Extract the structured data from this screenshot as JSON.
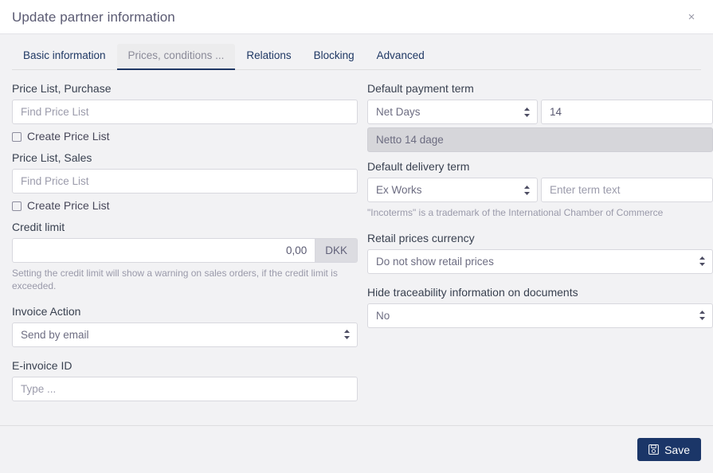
{
  "header": {
    "title": "Update partner information",
    "close_label": "×"
  },
  "tabs": [
    {
      "label": "Basic information",
      "active": false
    },
    {
      "label": "Prices, conditions ...",
      "active": true
    },
    {
      "label": "Relations",
      "active": false
    },
    {
      "label": "Blocking",
      "active": false
    },
    {
      "label": "Advanced",
      "active": false
    }
  ],
  "left_column": {
    "price_list_purchase": {
      "label": "Price List, Purchase",
      "placeholder": "Find Price List",
      "value": "",
      "checkbox_label": "Create Price List",
      "checked": false
    },
    "price_list_sales": {
      "label": "Price List, Sales",
      "placeholder": "Find Price List",
      "value": "",
      "checkbox_label": "Create Price List",
      "checked": false
    },
    "credit_limit": {
      "label": "Credit limit",
      "value": "0,00",
      "currency": "DKK",
      "help": "Setting the credit limit will show a warning on sales orders, if the credit limit is exceeded."
    },
    "invoice_action": {
      "label": "Invoice Action",
      "value": "Send by email"
    },
    "e_invoice_id": {
      "label": "E-invoice ID",
      "placeholder": "Type ...",
      "value": ""
    }
  },
  "right_column": {
    "default_payment_term": {
      "label": "Default payment term",
      "type_value": "Net Days",
      "days_value": "14",
      "description_value": "Netto 14 dage"
    },
    "default_delivery_term": {
      "label": "Default delivery term",
      "type_value": "Ex Works",
      "text_placeholder": "Enter term text",
      "text_value": "",
      "help": "\"Incoterms\" is a trademark of the International Chamber of Commerce"
    },
    "retail_prices_currency": {
      "label": "Retail prices currency",
      "value": "Do not show retail prices"
    },
    "hide_traceability": {
      "label": "Hide traceability information on documents",
      "value": "No"
    }
  },
  "footer": {
    "save_label": "Save"
  },
  "colors": {
    "accent": "#1b3668",
    "body_bg": "#f2f2f4",
    "header_bg": "#ffffff",
    "border": "#d8d8de"
  }
}
